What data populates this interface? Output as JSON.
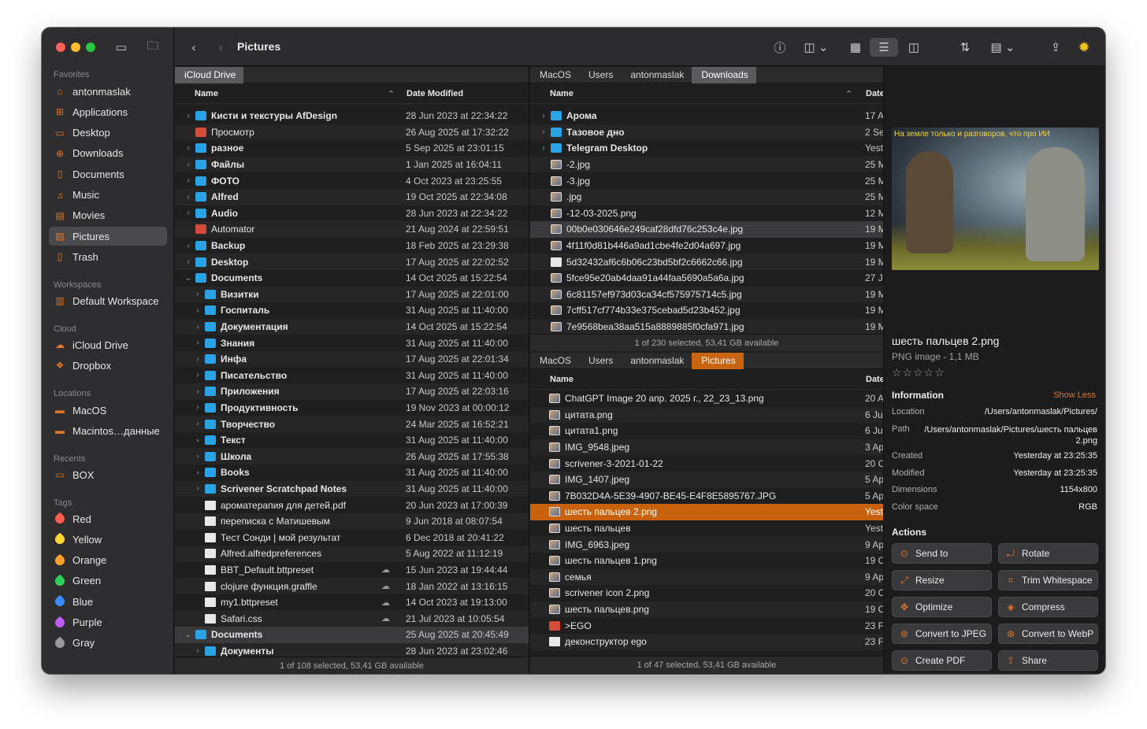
{
  "toolbar": {
    "title": "Pictures"
  },
  "sidebar": {
    "sections": {
      "favorites": "Favorites",
      "workspaces": "Workspaces",
      "cloud": "Cloud",
      "locations": "Locations",
      "recents": "Recents",
      "tags": "Tags"
    },
    "favorites": [
      {
        "label": "antonmaslak",
        "icon": "home-icon"
      },
      {
        "label": "Applications",
        "icon": "applications-icon"
      },
      {
        "label": "Desktop",
        "icon": "desktop-icon"
      },
      {
        "label": "Downloads",
        "icon": "downloads-icon"
      },
      {
        "label": "Documents",
        "icon": "documents-icon"
      },
      {
        "label": "Music",
        "icon": "music-icon"
      },
      {
        "label": "Movies",
        "icon": "movies-icon"
      },
      {
        "label": "Pictures",
        "icon": "pictures-icon"
      },
      {
        "label": "Trash",
        "icon": "trash-icon"
      }
    ],
    "workspaces": [
      {
        "label": "Default Workspace",
        "icon": "workspace-icon"
      }
    ],
    "cloud": [
      {
        "label": "iCloud Drive",
        "icon": "cloud-icon"
      },
      {
        "label": "Dropbox",
        "icon": "dropbox-icon"
      }
    ],
    "locations": [
      {
        "label": "MacOS",
        "icon": "disk-icon"
      },
      {
        "label": "Macintos…данные",
        "icon": "disk-icon"
      }
    ],
    "recents": [
      {
        "label": "BOX",
        "icon": "folder-icon"
      }
    ],
    "tags": [
      {
        "label": "Red",
        "color": "#ff5a52"
      },
      {
        "label": "Yellow",
        "color": "#ffd52e"
      },
      {
        "label": "Orange",
        "color": "#ff9f2e"
      },
      {
        "label": "Green",
        "color": "#30d158"
      },
      {
        "label": "Blue",
        "color": "#3a8cff"
      },
      {
        "label": "Purple",
        "color": "#bf5af2"
      },
      {
        "label": "Gray",
        "color": "#98989d"
      }
    ]
  },
  "left_pane": {
    "crumbs": [
      "iCloud Drive"
    ],
    "header": {
      "name": "Name",
      "date": "Date Modified"
    },
    "rows": [
      {
        "name": "Кисти и текстуры AfDesign",
        "date": "28 Jun 2023 at 22:34:22",
        "type": "folder"
      },
      {
        "name": "Просмотр",
        "date": "26 Aug 2025 at 17:32:22",
        "type": "app"
      },
      {
        "name": "разное",
        "date": "5 Sep 2025 at 23:01:15",
        "type": "folder"
      },
      {
        "name": "Файлы",
        "date": "1 Jan 2025 at 16:04:11",
        "type": "folder"
      },
      {
        "name": "ФОТО",
        "date": "4 Oct 2023 at 23:25:55",
        "type": "folder"
      },
      {
        "name": "Alfred",
        "date": "19 Oct 2025 at 22:34:08",
        "type": "folder"
      },
      {
        "name": "Audio",
        "date": "28 Jun 2023 at 22:34:22",
        "type": "folder"
      },
      {
        "name": "Automator",
        "date": "21 Aug 2024 at 22:59:51",
        "type": "app"
      },
      {
        "name": "Backup",
        "date": "18 Feb 2025 at 23:29:38",
        "type": "folder"
      },
      {
        "name": "Desktop",
        "date": "17 Aug 2025 at 22:02:52",
        "type": "folder"
      },
      {
        "name": "Documents",
        "date": "14 Oct 2025 at 15:22:54",
        "type": "folder",
        "open": true
      },
      {
        "name": "Визитки",
        "date": "17 Aug 2025 at 22:01:00",
        "type": "folder",
        "indent": 1
      },
      {
        "name": "Госпиталь",
        "date": "31 Aug 2025 at 11:40:00",
        "type": "folder",
        "indent": 1
      },
      {
        "name": "Документация",
        "date": "14 Oct 2025 at 15:22:54",
        "type": "folder",
        "indent": 1
      },
      {
        "name": "Знания",
        "date": "31 Aug 2025 at 11:40:00",
        "type": "folder",
        "indent": 1
      },
      {
        "name": "Инфа",
        "date": "17 Aug 2025 at 22:01:34",
        "type": "folder",
        "indent": 1
      },
      {
        "name": "Писательство",
        "date": "31 Aug 2025 at 11:40:00",
        "type": "folder",
        "indent": 1
      },
      {
        "name": "Приложения",
        "date": "17 Aug 2025 at 22:03:16",
        "type": "folder",
        "indent": 1
      },
      {
        "name": "Продуктивность",
        "date": "19 Nov 2023 at 00:00:12",
        "type": "folder",
        "indent": 1
      },
      {
        "name": "Творчество",
        "date": "24 Mar 2025 at 16:52:21",
        "type": "folder",
        "indent": 1
      },
      {
        "name": "Текст",
        "date": "31 Aug 2025 at 11:40:00",
        "type": "folder",
        "indent": 1
      },
      {
        "name": "Школа",
        "date": "26 Aug 2025 at 17:55:38",
        "type": "folder",
        "indent": 1
      },
      {
        "name": "Books",
        "date": "31 Aug 2025 at 11:40:00",
        "type": "folder",
        "indent": 1
      },
      {
        "name": "Scrivener Scratchpad Notes",
        "date": "31 Aug 2025 at 11:40:00",
        "type": "folder",
        "indent": 1
      },
      {
        "name": "ароматерапия для детей.pdf",
        "date": "20 Jun 2023 at 17:00:39",
        "type": "file",
        "indent": 1
      },
      {
        "name": "переписка с Матишевым",
        "date": "9 Jun 2018 at 08:07:54",
        "type": "file",
        "indent": 1
      },
      {
        "name": "Тест Сонди | мой результат",
        "date": "6 Dec 2018 at 20:41:22",
        "type": "file",
        "indent": 1
      },
      {
        "name": "Alfred.alfredpreferences",
        "date": "5 Aug 2022 at 11:12:19",
        "type": "file",
        "indent": 1
      },
      {
        "name": "BBT_Default.bttpreset",
        "date": "15 Jun 2023 at 19:44:44",
        "type": "file",
        "indent": 1,
        "cloud": true
      },
      {
        "name": "clojure функция.graffle",
        "date": "18 Jan 2022 at 13:16:15",
        "type": "file",
        "indent": 1,
        "cloud": true
      },
      {
        "name": "my1.bttpreset",
        "date": "14 Oct 2023 at 19:13:00",
        "type": "file",
        "indent": 1,
        "cloud": true
      },
      {
        "name": "Safari.css",
        "date": "21 Jul 2023 at 10:05:54",
        "type": "file",
        "indent": 1,
        "cloud": true
      },
      {
        "name": "Documents",
        "date": "25 Aug 2025 at 20:45:49",
        "type": "folder",
        "open": true,
        "selected": true
      },
      {
        "name": "Документы",
        "date": "28 Jun 2023 at 23:02:46",
        "type": "folder",
        "indent": 1
      }
    ],
    "status": "1 of 108 selected, 53,41 GB available"
  },
  "top_pane": {
    "crumbs": [
      "MacOS",
      "Users",
      "antonmaslak",
      "Downloads"
    ],
    "header": {
      "name": "Name",
      "date": "Date"
    },
    "rows": [
      {
        "name": "Арома",
        "date": "17 A",
        "type": "folder"
      },
      {
        "name": "Тазовое дно",
        "date": "2 Se",
        "type": "folder"
      },
      {
        "name": "Telegram Desktop",
        "date": "Yest",
        "type": "folder"
      },
      {
        "name": "-2.jpg",
        "date": "25 M",
        "type": "img"
      },
      {
        "name": "-3.jpg",
        "date": "25 M",
        "type": "img"
      },
      {
        "name": ".jpg",
        "date": "25 M",
        "type": "img"
      },
      {
        "name": "-12-03-2025.png",
        "date": "12 M",
        "type": "img"
      },
      {
        "name": "00b0e030646e249caf28dfd76c253c4e.jpg",
        "date": "19 M",
        "type": "img",
        "selected": true
      },
      {
        "name": "4f11f0d81b446a9ad1cbe4fe2d04a697.jpg",
        "date": "19 M",
        "type": "img"
      },
      {
        "name": "5d32432af6c6b06c23bd5bf2c6662c66.jpg",
        "date": "19 M",
        "type": "file"
      },
      {
        "name": "5fce95e20ab4daa91a44faa5690a5a6a.jpg",
        "date": "27 J",
        "type": "img"
      },
      {
        "name": "6c81157ef973d03ca34cf575975714c5.jpg",
        "date": "19 M",
        "type": "img"
      },
      {
        "name": "7cff517cf774b33e375cebad5d23b452.jpg",
        "date": "19 M",
        "type": "img"
      },
      {
        "name": "7e9568bea38aa515a8889885f0cfa971.jpg",
        "date": "19 M",
        "type": "img"
      }
    ],
    "status": "1 of 230 selected, 53,41 GB available"
  },
  "bottom_pane": {
    "crumbs": [
      "MacOS",
      "Users",
      "antonmaslak",
      "Pictures"
    ],
    "header": {
      "name": "Name",
      "date": "Date"
    },
    "rows": [
      {
        "name": "ChatGPT Image 20 апр. 2025 г., 22_23_13.png",
        "date": "20 A",
        "type": "img"
      },
      {
        "name": "цитата.png",
        "date": "6 Ju",
        "type": "img"
      },
      {
        "name": "цитата1.png",
        "date": "6 Ju",
        "type": "img"
      },
      {
        "name": "IMG_9548.jpeg",
        "date": "3 Ap",
        "type": "img"
      },
      {
        "name": "scrivener-3-2021-01-22",
        "date": "20 C",
        "type": "img"
      },
      {
        "name": "IMG_1407.jpeg",
        "date": "5 Ap",
        "type": "img"
      },
      {
        "name": "7B032D4A-5E39-4907-BE45-E4F8E5895767.JPG",
        "date": "5 Ap",
        "type": "img"
      },
      {
        "name": "шесть пальцев 2.png",
        "date": "Yest",
        "type": "img",
        "highlight": true
      },
      {
        "name": "шесть пальцев",
        "date": "Yest",
        "type": "img"
      },
      {
        "name": "IMG_6963.jpeg",
        "date": "9 Ap",
        "type": "img"
      },
      {
        "name": "шесть пальцев 1.png",
        "date": "19 O",
        "type": "img"
      },
      {
        "name": "семья",
        "date": "9 Ap",
        "type": "img"
      },
      {
        "name": "scrivener icon 2.png",
        "date": "20 C",
        "type": "img"
      },
      {
        "name": "шесть пальцев.png",
        "date": "19 O",
        "type": "img"
      },
      {
        "name": ">EGO",
        "date": "23 F",
        "type": "app"
      },
      {
        "name": "деконструктор ego",
        "date": "23 F",
        "type": "file"
      }
    ],
    "status": "1 of 47 selected, 53,41 GB available"
  },
  "preview": {
    "caption": "На земле только и разговоров, что про ИИ",
    "filename": "шесть пальцев 2.png",
    "kind": "PNG image - 1,1 MB",
    "stars": "☆☆☆☆☆",
    "info_title": "Information",
    "show_less": "Show Less",
    "info": [
      {
        "k": "Location",
        "v": "/Users/antonmaslak/Pictures/"
      },
      {
        "k": "Path",
        "v": "/Users/antonmaslak/Pictures/шесть пальцев 2.png"
      },
      {
        "k": "Created",
        "v": "Yesterday at 23:25:35"
      },
      {
        "k": "Modified",
        "v": "Yesterday at 23:25:35"
      },
      {
        "k": "Dimensions",
        "v": "1154x800"
      },
      {
        "k": "Color space",
        "v": "RGB"
      }
    ],
    "actions_title": "Actions",
    "actions": [
      {
        "label": "Send to",
        "icon": "send-icon"
      },
      {
        "label": "Rotate",
        "icon": "rotate-icon"
      },
      {
        "label": "Resize",
        "icon": "resize-icon"
      },
      {
        "label": "Trim Whitespace",
        "icon": "trim-icon"
      },
      {
        "label": "Optimize",
        "icon": "optimize-icon"
      },
      {
        "label": "Compress",
        "icon": "compress-icon"
      },
      {
        "label": "Convert to JPEG",
        "icon": "convert-icon"
      },
      {
        "label": "Convert to WebP",
        "icon": "convert-icon"
      },
      {
        "label": "Create PDF",
        "icon": "pdf-icon"
      },
      {
        "label": "Share",
        "icon": "share-icon"
      }
    ]
  }
}
